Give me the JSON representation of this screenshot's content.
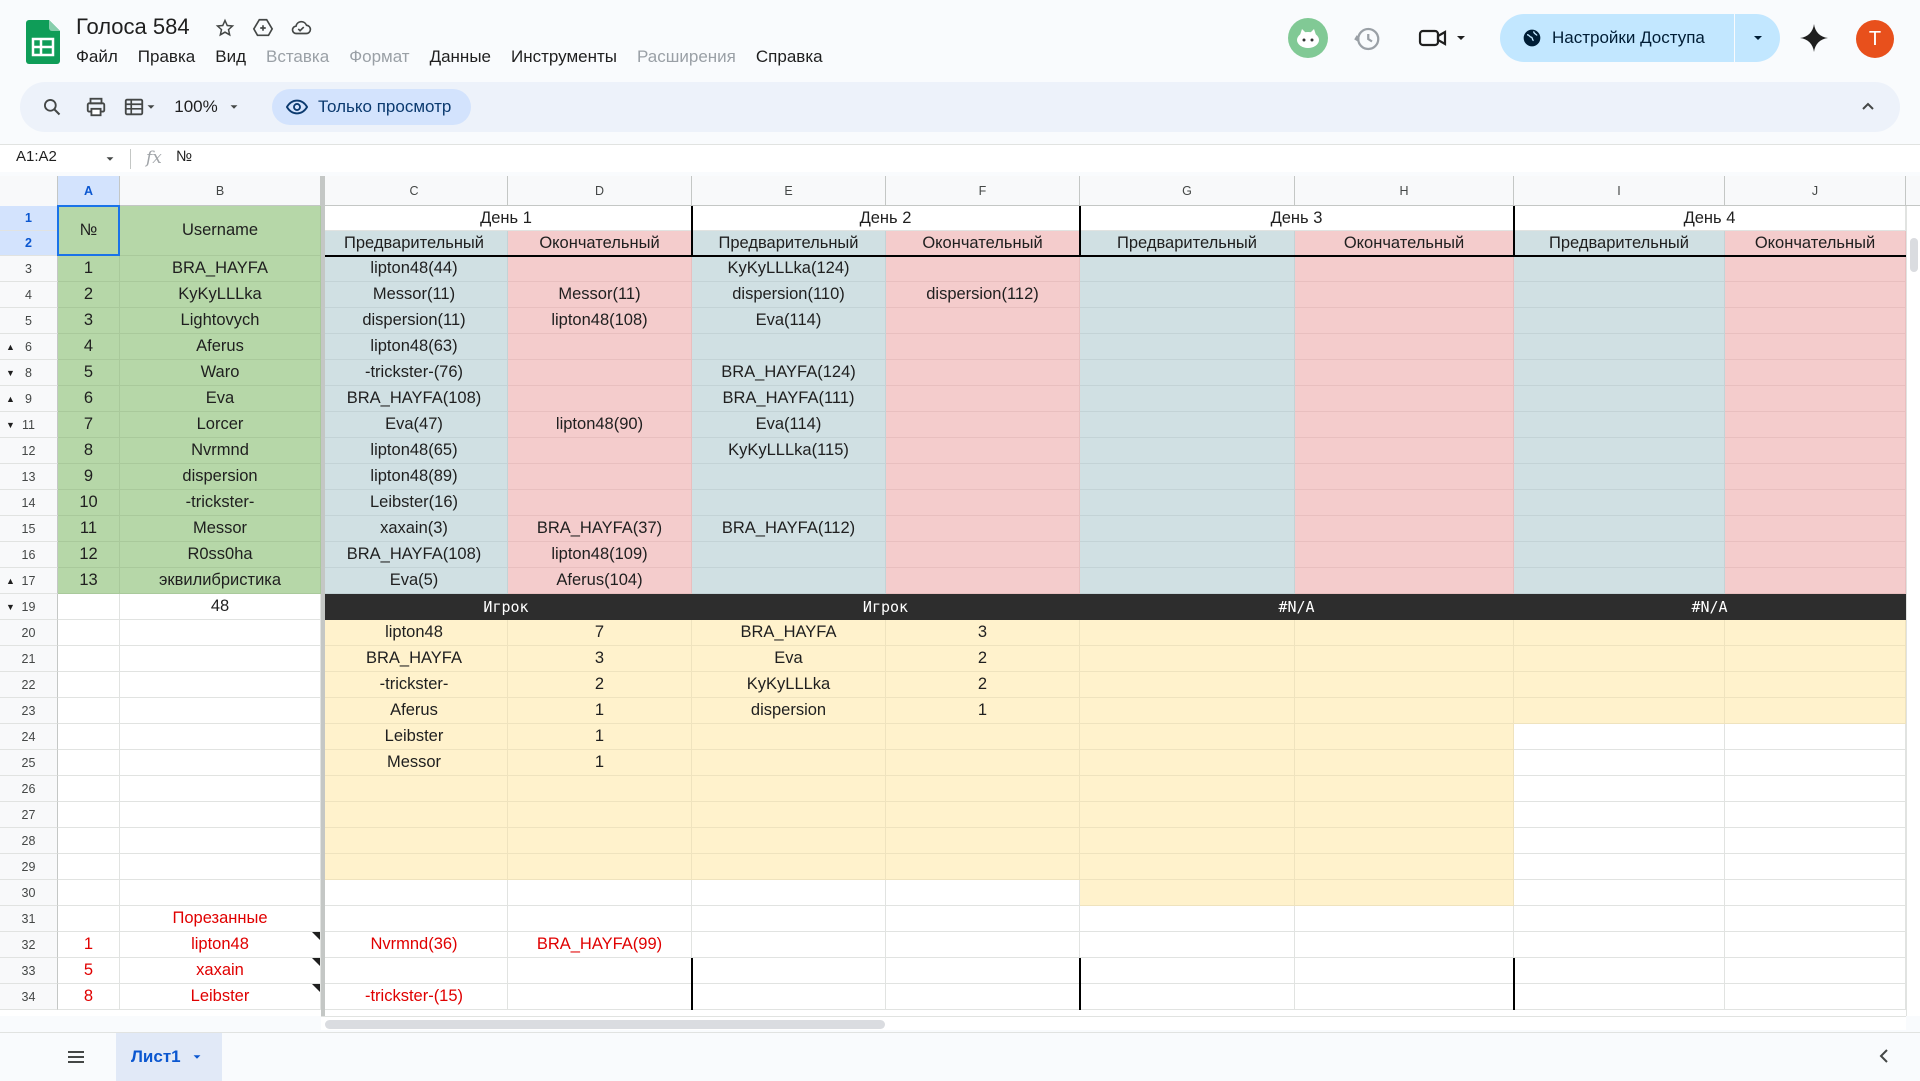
{
  "doc": {
    "title": "Голоса 584"
  },
  "menu": [
    "Файл",
    "Правка",
    "Вид",
    "Вставка",
    "Формат",
    "Данные",
    "Инструменты",
    "Расширения",
    "Справка"
  ],
  "menu_disabled": [
    false,
    false,
    false,
    true,
    true,
    false,
    false,
    true,
    false
  ],
  "share": {
    "label": "Настройки Доступа"
  },
  "user": {
    "initial": "T",
    "color": "#e8501c"
  },
  "toolbar": {
    "zoom": "100%",
    "view_only": "Только просмотр"
  },
  "formula": {
    "namebox": "A1:A2",
    "fx": "fx",
    "value": "№"
  },
  "columns": [
    "A",
    "B",
    "C",
    "D",
    "E",
    "F",
    "G",
    "H",
    "I",
    "J"
  ],
  "rows": [
    "1",
    "2",
    "3",
    "4",
    "5",
    "6",
    "8",
    "9",
    "11",
    "12",
    "13",
    "14",
    "15",
    "16",
    "17",
    "19",
    "20",
    "21",
    "22",
    "23",
    "24",
    "25",
    "26",
    "27",
    "28",
    "29",
    "30",
    "31",
    "32",
    "33",
    "34"
  ],
  "header": {
    "num": "№",
    "username": "Username",
    "days": [
      "День 1",
      "День 2",
      "День 3",
      "День 4"
    ],
    "prelim": "Предварительный",
    "final": "Окончательный"
  },
  "players": [
    {
      "n": "1",
      "name": "BRA_HAYFA",
      "c": "lipton48(44)",
      "d": "",
      "e": "KyKyLLLka(124)",
      "f": ""
    },
    {
      "n": "2",
      "name": "KyKyLLLka",
      "c": "Messor(11)",
      "d": "Messor(11)",
      "e": "dispersion(110)",
      "f": "dispersion(112)"
    },
    {
      "n": "3",
      "name": "Lightovych",
      "c": "dispersion(11)",
      "d": "lipton48(108)",
      "e": "Eva(114)",
      "f": ""
    },
    {
      "n": "4",
      "name": "Aferus",
      "c": "lipton48(63)",
      "d": "",
      "e": "",
      "f": ""
    },
    {
      "n": "5",
      "name": "Waro",
      "c": "-trickster-(76)",
      "d": "",
      "e": "BRA_HAYFA(124)",
      "f": ""
    },
    {
      "n": "6",
      "name": "Eva",
      "c": "BRA_HAYFA(108)",
      "d": "",
      "e": "BRA_HAYFA(111)",
      "f": ""
    },
    {
      "n": "7",
      "name": "Lorcer",
      "c": "Eva(47)",
      "d": "lipton48(90)",
      "e": "Eva(114)",
      "f": ""
    },
    {
      "n": "8",
      "name": "Nvrmnd",
      "c": "lipton48(65)",
      "d": "",
      "e": "KyKyLLLka(115)",
      "f": ""
    },
    {
      "n": "9",
      "name": "dispersion",
      "c": "lipton48(89)",
      "d": "",
      "e": "",
      "f": ""
    },
    {
      "n": "10",
      "name": "-trickster-",
      "c": "Leibster(16)",
      "d": "",
      "e": "",
      "f": ""
    },
    {
      "n": "11",
      "name": "Messor",
      "c": "xaxain(3)",
      "d": "BRA_HAYFA(37)",
      "e": "BRA_HAYFA(112)",
      "f": ""
    },
    {
      "n": "12",
      "name": "R0ss0ha",
      "c": "BRA_HAYFA(108)",
      "d": "lipton48(109)",
      "e": "",
      "f": ""
    },
    {
      "n": "13",
      "name": "эквилибристика",
      "c": "Eva(5)",
      "d": "Aferus(104)",
      "e": "",
      "f": ""
    }
  ],
  "count_b19": "48",
  "summary_headers": [
    "Игрок",
    "Игрок",
    "#N/A",
    "#N/A"
  ],
  "summary": {
    "day1": [
      [
        "lipton48",
        "7"
      ],
      [
        "BRA_HAYFA",
        "3"
      ],
      [
        "-trickster-",
        "2"
      ],
      [
        "Aferus",
        "1"
      ],
      [
        "Leibster",
        "1"
      ],
      [
        "Messor",
        "1"
      ]
    ],
    "day2": [
      [
        "BRA_HAYFA",
        "3"
      ],
      [
        "Eva",
        "2"
      ],
      [
        "KyKyLLLka",
        "2"
      ],
      [
        "dispersion",
        "1"
      ]
    ]
  },
  "cut": {
    "label": "Порезанные",
    "rows": [
      {
        "n": "1",
        "name": "lipton48",
        "c": "Nvrmnd(36)",
        "d": "BRA_HAYFA(99)"
      },
      {
        "n": "5",
        "name": "xaxain",
        "c": "",
        "d": ""
      },
      {
        "n": "8",
        "name": "Leibster",
        "c": "-trickster-(15)",
        "d": ""
      }
    ]
  },
  "sheet": {
    "name": "Лист1"
  }
}
